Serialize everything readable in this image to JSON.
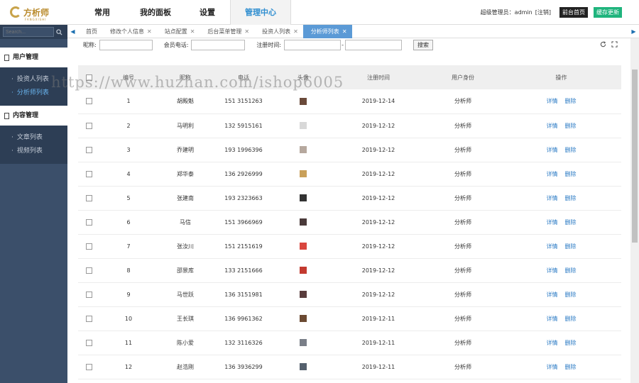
{
  "app": {
    "logo_text": "方析师",
    "logo_sub": "FANGXISHI"
  },
  "topnav": {
    "items": [
      "常用",
      "我的面板",
      "设置",
      "管理中心"
    ],
    "active_index": 3
  },
  "userbar": {
    "role_label": "超级管理员：admin",
    "logout_label": "[注销]",
    "home_button": "前台首页",
    "refresh_button": "缓存更新"
  },
  "sidebar": {
    "search_placeholder": "Search...",
    "groups": [
      {
        "title": "用户管理",
        "items": [
          "投资人列表",
          "分析师列表"
        ],
        "active_item": 1
      },
      {
        "title": "内容管理",
        "items": [
          "文章列表",
          "视频列表"
        ],
        "active_item": -1
      }
    ]
  },
  "tabs": {
    "items": [
      "首页",
      "修改个人信息",
      "站点配置",
      "后台菜单管理",
      "投资人列表",
      "分析师列表"
    ],
    "active_index": 5
  },
  "filters": {
    "nickname_label": "昵称:",
    "phone_label": "会员电话:",
    "regtime_label": "注册时间:",
    "range_sep": "-",
    "search_button": "搜索"
  },
  "table": {
    "headers": [
      "",
      "编号",
      "昵称",
      "电话",
      "头像",
      "注册时间",
      "用户身份",
      "操作"
    ],
    "detail_label": "详情",
    "delete_label": "删除",
    "rows": [
      {
        "id": "1",
        "name": "胡殿魁",
        "phone": "151 3151263",
        "date": "2019-12-14",
        "role": "分析师",
        "avatar": "#6a4a3a"
      },
      {
        "id": "2",
        "name": "马明利",
        "phone": "132 5915161",
        "date": "2019-12-12",
        "role": "分析师",
        "avatar": "#d8d8d8"
      },
      {
        "id": "3",
        "name": "乔建明",
        "phone": "193 1996396",
        "date": "2019-12-12",
        "role": "分析师",
        "avatar": "#b6a89e"
      },
      {
        "id": "4",
        "name": "郑华泰",
        "phone": "136 2926999",
        "date": "2019-12-12",
        "role": "分析师",
        "avatar": "#c9a05a"
      },
      {
        "id": "5",
        "name": "张建南",
        "phone": "193 2323663",
        "date": "2019-12-12",
        "role": "分析师",
        "avatar": "#333333"
      },
      {
        "id": "6",
        "name": "马信",
        "phone": "151 3966969",
        "date": "2019-12-12",
        "role": "分析师",
        "avatar": "#4a3a3a"
      },
      {
        "id": "7",
        "name": "张汝川",
        "phone": "151 2151619",
        "date": "2019-12-12",
        "role": "分析师",
        "avatar": "#d9463e"
      },
      {
        "id": "8",
        "name": "邵景库",
        "phone": "133 2151666",
        "date": "2019-12-12",
        "role": "分析师",
        "avatar": "#c33a2f"
      },
      {
        "id": "9",
        "name": "马世跃",
        "phone": "136 3151981",
        "date": "2019-12-12",
        "role": "分析师",
        "avatar": "#5a3d3d"
      },
      {
        "id": "10",
        "name": "王长琪",
        "phone": "136 9961362",
        "date": "2019-12-11",
        "role": "分析师",
        "avatar": "#6b4a32"
      },
      {
        "id": "11",
        "name": "陈小爱",
        "phone": "132 3116326",
        "date": "2019-12-11",
        "role": "分析师",
        "avatar": "#7a7f88"
      },
      {
        "id": "12",
        "name": "赵浩刚",
        "phone": "136 3936299",
        "date": "2019-12-11",
        "role": "分析师",
        "avatar": "#55606d"
      }
    ]
  },
  "watermark": "https://www.huzhan.com/ishop6005",
  "colors": {
    "sidebar_bg": "#3b4f6a",
    "accent_blue": "#2f8ed0",
    "tab_active": "#5b9ad6",
    "link": "#2a7ac4",
    "green": "#1fb47d"
  }
}
